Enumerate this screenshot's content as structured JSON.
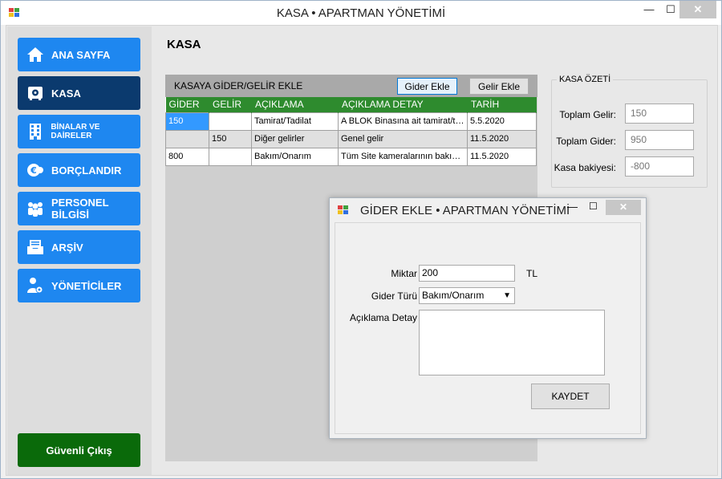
{
  "window": {
    "title": "KASA • APARTMAN YÖNETİMİ",
    "min_glyph": "—",
    "max_glyph": "☐",
    "close_glyph": "✕"
  },
  "sidebar": {
    "items": [
      {
        "label": "ANA SAYFA",
        "icon": "home-icon"
      },
      {
        "label": "KASA",
        "icon": "safe-icon",
        "active": true
      },
      {
        "label": "BİNALAR VE DAİRELER",
        "icon": "building-icon"
      },
      {
        "label": "BORÇLANDIR",
        "icon": "euro-coin-icon"
      },
      {
        "label": "PERSONEL BİLGİSİ",
        "icon": "people-icon"
      },
      {
        "label": "ARŞİV",
        "icon": "archive-icon"
      },
      {
        "label": "YÖNETİCİLER",
        "icon": "admin-gear-icon"
      }
    ],
    "exit_label": "Güvenli Çıkış"
  },
  "page": {
    "title": "KASA"
  },
  "panel": {
    "title": "KASAYA GİDER/GELİR EKLE",
    "add_expense_label": "Gider Ekle",
    "add_income_label": "Gelir Ekle",
    "columns": [
      "GİDER",
      "GELİR",
      "AÇIKLAMA",
      "AÇIKLAMA DETAY",
      "TARİH"
    ],
    "rows": [
      [
        "150",
        "",
        "Tamirat/Tadilat",
        "A BLOK Binasına ait tamirat/ta...",
        "5.5.2020"
      ],
      [
        "",
        "150",
        "Diğer gelirler",
        "Genel gelir",
        "11.5.2020"
      ],
      [
        "800",
        "",
        "Bakım/Onarım",
        "Tüm Site kameralarının bakımı ...",
        "11.5.2020"
      ]
    ]
  },
  "summary": {
    "title": "KASA ÖZETİ",
    "total_income_label": "Toplam Gelir:",
    "total_income": "150",
    "total_expense_label": "Toplam Gider:",
    "total_expense": "950",
    "balance_label": "Kasa bakiyesi:",
    "balance": "-800"
  },
  "dialog": {
    "title": "GİDER EKLE • APARTMAN YÖNETİMİ",
    "amount_label": "Miktar",
    "amount_value": "200",
    "currency": "TL",
    "type_label": "Gider Türü",
    "type_value": "Bakım/Onarım",
    "detail_label": "Açıklama Detay",
    "detail_value": "",
    "save_label": "KAYDET"
  },
  "colors": {
    "nav_blue": "#1e87f0",
    "nav_active": "#0b3a6e",
    "exit_green": "#0a6a0a",
    "grid_header_green": "#2e8b2e",
    "selection_blue": "#3399ff"
  }
}
